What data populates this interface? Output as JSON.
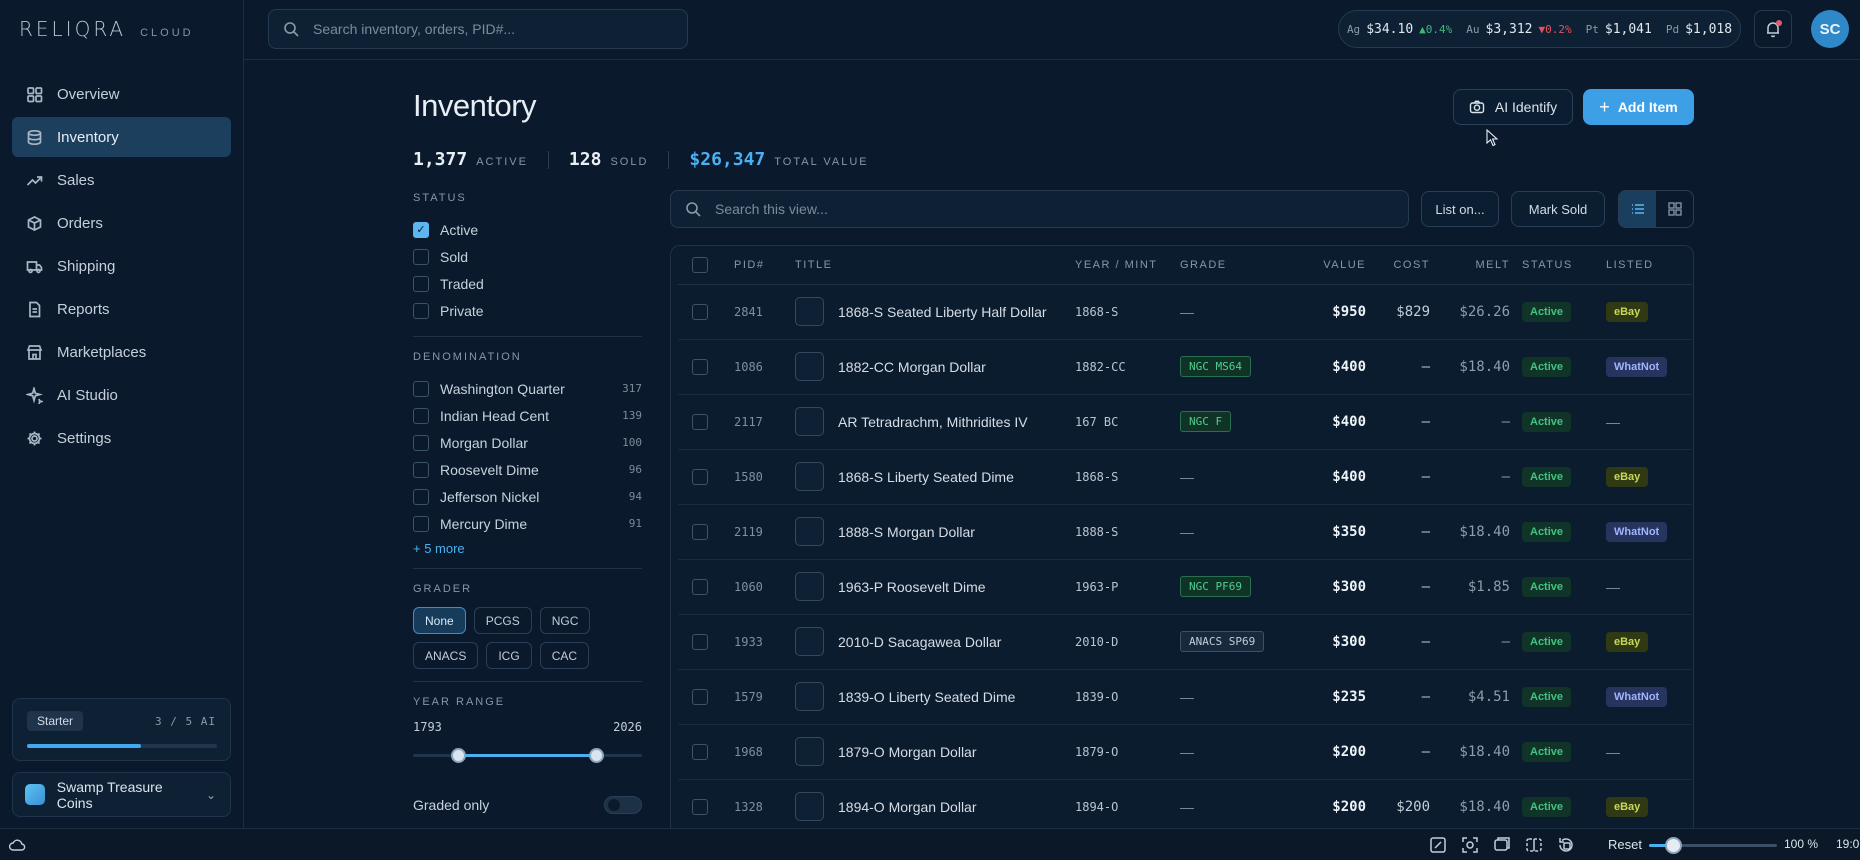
{
  "app": {
    "logo": "RELIQRA",
    "logo_sub": "CLOUD"
  },
  "sidebar": {
    "items": [
      {
        "label": "Overview",
        "icon": "grid-icon"
      },
      {
        "label": "Inventory",
        "icon": "database-icon",
        "active": true
      },
      {
        "label": "Sales",
        "icon": "trending-up-icon"
      },
      {
        "label": "Orders",
        "icon": "box-icon"
      },
      {
        "label": "Shipping",
        "icon": "truck-icon"
      },
      {
        "label": "Reports",
        "icon": "report-icon"
      },
      {
        "label": "Marketplaces",
        "icon": "store-icon"
      },
      {
        "label": "AI Studio",
        "icon": "sparkle-icon"
      },
      {
        "label": "Settings",
        "icon": "gear-icon"
      }
    ],
    "plan": {
      "name": "Starter",
      "usage": "3 / 5 AI",
      "progress": 0.6
    },
    "store": {
      "name": "Swamp Treasure Coins"
    }
  },
  "topbar": {
    "search_placeholder": "Search inventory, orders, PID#...",
    "ticker": [
      {
        "sym": "Ag",
        "price": "$34.10",
        "change": "▲0.4%",
        "dir": "up"
      },
      {
        "sym": "Au",
        "price": "$3,312",
        "change": "▼0.2%",
        "dir": "down"
      },
      {
        "sym": "Pt",
        "price": "$1,041",
        "change": "",
        "dir": ""
      },
      {
        "sym": "Pd",
        "price": "$1,018",
        "change": "",
        "dir": ""
      }
    ],
    "avatar": "SC"
  },
  "page": {
    "title": "Inventory",
    "ai_identify": "AI Identify",
    "add_item": "Add Item",
    "stats": {
      "active_num": "1,377",
      "active_lbl": "ACTIVE",
      "sold_num": "128",
      "sold_lbl": "SOLD",
      "value_num": "$26,347",
      "value_lbl": "TOTAL VALUE"
    }
  },
  "filters": {
    "status_head": "STATUS",
    "status": [
      {
        "label": "Active",
        "checked": true
      },
      {
        "label": "Sold",
        "checked": false
      },
      {
        "label": "Traded",
        "checked": false
      },
      {
        "label": "Private",
        "checked": false
      }
    ],
    "denom_head": "DENOMINATION",
    "denominations": [
      {
        "label": "Washington Quarter",
        "count": "317"
      },
      {
        "label": "Indian Head Cent",
        "count": "139"
      },
      {
        "label": "Morgan Dollar",
        "count": "100"
      },
      {
        "label": "Roosevelt Dime",
        "count": "96"
      },
      {
        "label": "Jefferson Nickel",
        "count": "94"
      },
      {
        "label": "Mercury Dime",
        "count": "91"
      }
    ],
    "more": "+ 5 more",
    "grader_head": "GRADER",
    "graders": [
      "None",
      "PCGS",
      "NGC",
      "ANACS",
      "ICG",
      "CAC"
    ],
    "year_head": "YEAR RANGE",
    "year_min": "1793",
    "year_max": "2026",
    "graded_only": "Graded only"
  },
  "toolbar": {
    "search_placeholder": "Search this view...",
    "list_on": "List on...",
    "mark_sold": "Mark Sold"
  },
  "table": {
    "headers": {
      "pid": "PID#",
      "title": "TITLE",
      "year": "YEAR / MINT",
      "grade": "GRADE",
      "value": "VALUE",
      "cost": "COST",
      "melt": "MELT",
      "status": "STATUS",
      "listed": "LISTED"
    },
    "rows": [
      {
        "pid": "2841",
        "title": "1868-S Seated Liberty Half Dollar",
        "year": "1868-S",
        "grade": "—",
        "grade_style": "none",
        "value": "$950",
        "cost": "$829",
        "melt": "$26.26",
        "status": "Active",
        "listed": "eBay"
      },
      {
        "pid": "1086",
        "title": "1882-CC Morgan Dollar",
        "year": "1882-CC",
        "grade": "NGC MS64",
        "grade_style": "green",
        "value": "$400",
        "cost": "—",
        "melt": "$18.40",
        "status": "Active",
        "listed": "WhatNot"
      },
      {
        "pid": "2117",
        "title": "AR Tetradrachm, Mithridites IV",
        "year": "167 BC",
        "grade": "NGC F",
        "grade_style": "green",
        "value": "$400",
        "cost": "—",
        "melt": "—",
        "status": "Active",
        "listed": "—"
      },
      {
        "pid": "1580",
        "title": "1868-S Liberty Seated Dime",
        "year": "1868-S",
        "grade": "—",
        "grade_style": "none",
        "value": "$400",
        "cost": "—",
        "melt": "—",
        "status": "Active",
        "listed": "eBay"
      },
      {
        "pid": "2119",
        "title": "1888-S Morgan Dollar",
        "year": "1888-S",
        "grade": "—",
        "grade_style": "none",
        "value": "$350",
        "cost": "—",
        "melt": "$18.40",
        "status": "Active",
        "listed": "WhatNot"
      },
      {
        "pid": "1060",
        "title": "1963-P Roosevelt Dime",
        "year": "1963-P",
        "grade": "NGC PF69",
        "grade_style": "green",
        "value": "$300",
        "cost": "—",
        "melt": "$1.85",
        "status": "Active",
        "listed": "—"
      },
      {
        "pid": "1933",
        "title": "2010-D Sacagawea Dollar",
        "year": "2010-D",
        "grade": "ANACS SP69",
        "grade_style": "gray",
        "value": "$300",
        "cost": "—",
        "melt": "—",
        "status": "Active",
        "listed": "eBay"
      },
      {
        "pid": "1579",
        "title": "1839-O Liberty Seated Dime",
        "year": "1839-O",
        "grade": "—",
        "grade_style": "none",
        "value": "$235",
        "cost": "—",
        "melt": "$4.51",
        "status": "Active",
        "listed": "WhatNot"
      },
      {
        "pid": "1968",
        "title": "1879-O Morgan Dollar",
        "year": "1879-O",
        "grade": "—",
        "grade_style": "none",
        "value": "$200",
        "cost": "—",
        "melt": "$18.40",
        "status": "Active",
        "listed": "—"
      },
      {
        "pid": "1328",
        "title": "1894-O Morgan Dollar",
        "year": "1894-O",
        "grade": "—",
        "grade_style": "none",
        "value": "$200",
        "cost": "$200",
        "melt": "$18.40",
        "status": "Active",
        "listed": "eBay"
      }
    ]
  },
  "bottombar": {
    "reset": "Reset",
    "zoom": "100 %",
    "zoom_level": 0.15,
    "time": "19:0"
  }
}
